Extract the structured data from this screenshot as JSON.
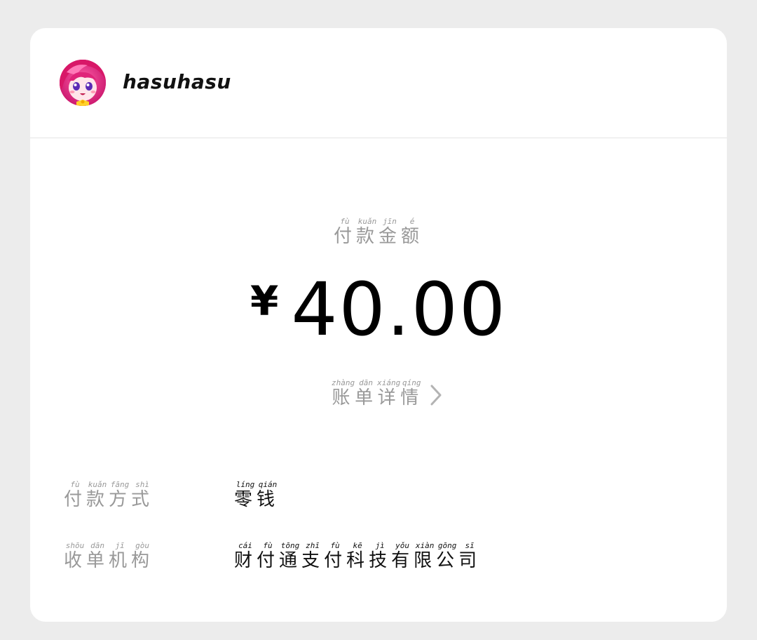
{
  "header": {
    "username": "hasuhasu"
  },
  "amount_label": [
    {
      "char": "付",
      "pinyin": "fù"
    },
    {
      "char": "款",
      "pinyin": "kuǎn"
    },
    {
      "char": "金",
      "pinyin": "jīn"
    },
    {
      "char": "额",
      "pinyin": "é"
    }
  ],
  "amount": {
    "currency": "¥",
    "value": "40.00"
  },
  "detail_link": [
    {
      "char": "账",
      "pinyin": "zhàng"
    },
    {
      "char": "单",
      "pinyin": "dān"
    },
    {
      "char": "详",
      "pinyin": "xiáng"
    },
    {
      "char": "情",
      "pinyin": "qíng"
    }
  ],
  "details": [
    {
      "label": [
        {
          "char": "付",
          "pinyin": "fù"
        },
        {
          "char": "款",
          "pinyin": "kuǎn"
        },
        {
          "char": "方",
          "pinyin": "fāng"
        },
        {
          "char": "式",
          "pinyin": "shì"
        }
      ],
      "value": [
        {
          "char": "零",
          "pinyin": "líng"
        },
        {
          "char": "钱",
          "pinyin": "qián"
        }
      ]
    },
    {
      "label": [
        {
          "char": "收",
          "pinyin": "shōu"
        },
        {
          "char": "单",
          "pinyin": "dān"
        },
        {
          "char": "机",
          "pinyin": "jī"
        },
        {
          "char": "构",
          "pinyin": "gòu"
        }
      ],
      "value": [
        {
          "char": "财",
          "pinyin": "cái"
        },
        {
          "char": "付",
          "pinyin": "fù"
        },
        {
          "char": "通",
          "pinyin": "tōng"
        },
        {
          "char": "支",
          "pinyin": "zhī"
        },
        {
          "char": "付",
          "pinyin": "fù"
        },
        {
          "char": "科",
          "pinyin": "kē"
        },
        {
          "char": "技",
          "pinyin": "jì"
        },
        {
          "char": "有",
          "pinyin": "yǒu"
        },
        {
          "char": "限",
          "pinyin": "xiàn"
        },
        {
          "char": "公",
          "pinyin": "gōng"
        },
        {
          "char": "司",
          "pinyin": "sī"
        }
      ]
    }
  ],
  "icons": {
    "avatar": "anime-girl-avatar",
    "chevron": "chevron-right-icon"
  },
  "colors": {
    "background": "#ececec",
    "card": "#ffffff",
    "label_gray": "#999999",
    "text_dark": "#111111",
    "avatar_pink": "#e8297a"
  }
}
